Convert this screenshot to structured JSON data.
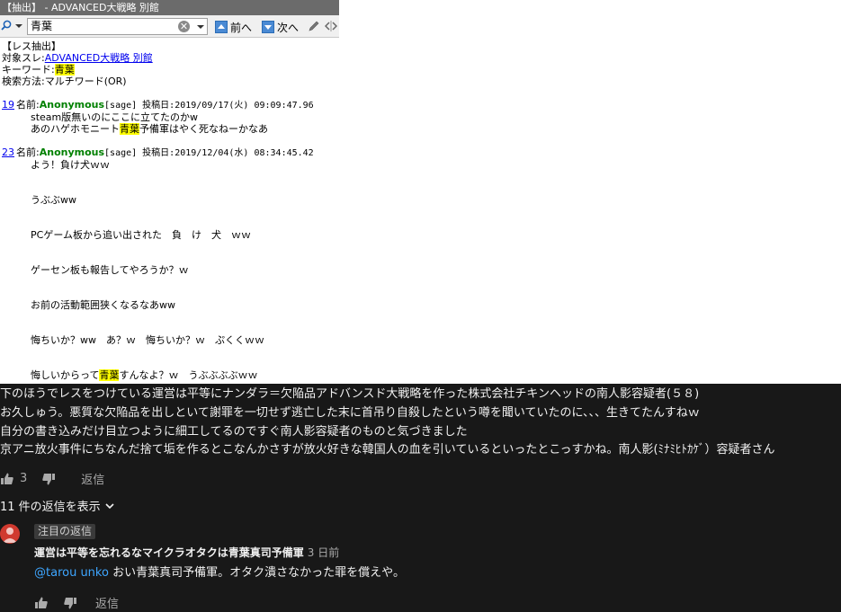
{
  "window": {
    "title": "【抽出】 - ADVANCED大戦略 別館"
  },
  "toolbar": {
    "search_value": "青葉",
    "clear_glyph": "✕",
    "prev_label": "前へ",
    "next_label": "次へ"
  },
  "extract": {
    "header": "【レス抽出】",
    "target_label": "対象スレ:",
    "target_link": "ADVANCED大戦略 別館",
    "keyword_label": "キーワード:",
    "keyword": "青葉",
    "method_line": "検索方法:マルチワード(OR)"
  },
  "posts": [
    {
      "number": "19",
      "name_label": "名前:",
      "name": "Anonymous",
      "mail": "[sage]",
      "date": " 投稿日:2019/09/17(火) 09:09:47.96",
      "lines": [
        {
          "pre": "steam版無いのにここに立てたのかw",
          "hl": "",
          "post": ""
        },
        {
          "pre": "あのハゲホモニート",
          "hl": "青葉",
          "post": "予備軍はやく死なねーかなあ"
        }
      ]
    },
    {
      "number": "23",
      "name_label": "名前:",
      "name": "Anonymous",
      "mail": "[sage]",
      "date": " 投稿日:2019/12/04(水) 08:34:45.42",
      "lines": [
        {
          "pre": "よう！負け犬ｗｗ",
          "hl": "",
          "post": ""
        },
        {
          "pre": "",
          "hl": "",
          "post": ""
        },
        {
          "pre": "",
          "hl": "",
          "post": ""
        },
        {
          "pre": "うぶぶww",
          "hl": "",
          "post": ""
        },
        {
          "pre": "",
          "hl": "",
          "post": ""
        },
        {
          "pre": "",
          "hl": "",
          "post": ""
        },
        {
          "pre": "PCゲーム板から追い出された　負　け　犬　ｗｗ",
          "hl": "",
          "post": ""
        },
        {
          "pre": "",
          "hl": "",
          "post": ""
        },
        {
          "pre": "",
          "hl": "",
          "post": ""
        },
        {
          "pre": "ゲーセン板も報告してやろうか？ｗ",
          "hl": "",
          "post": ""
        },
        {
          "pre": "",
          "hl": "",
          "post": ""
        },
        {
          "pre": "",
          "hl": "",
          "post": ""
        },
        {
          "pre": "お前の活動範囲狭くなるなあww",
          "hl": "",
          "post": ""
        },
        {
          "pre": "",
          "hl": "",
          "post": ""
        },
        {
          "pre": "",
          "hl": "",
          "post": ""
        },
        {
          "pre": "悔ちいか？ww　あ？ｗ　悔ちいか？ｗ　ぷくくｗｗ",
          "hl": "",
          "post": ""
        },
        {
          "pre": "",
          "hl": "",
          "post": ""
        },
        {
          "pre": "",
          "hl": "",
          "post": ""
        },
        {
          "pre": "悔しいからって",
          "hl": "青葉",
          "post": "すんなよ？ｗ　うぶぶぶぶｗｗ"
        }
      ]
    }
  ],
  "comment": {
    "lines": [
      "下のほうでレスをつけている運営は平等にナンダラ＝欠陥品アドバンスド大戦略を作った株式会社チキンヘッドの南人影容疑者(５８)",
      "お久しゅう。悪質な欠陥品を出しといて謝罪を一切せず逃亡した末に首吊り自殺したという噂を聞いていたのに、、、生きてたんすねｗ",
      "自分の書き込みだけ目立つように細工してるのですぐ南人影容疑者のものと気づきました",
      "京アニ放火事件にちなんだ捨て垢を作るとこなんかさすが放火好きな韓国人の血を引いているといったとこっすかね。南人影(ﾐﾅﾐﾋﾄｶｹﾞ）容疑者さん"
    ],
    "like_count": "3",
    "reply_label": "返信",
    "replies_toggle": "11 件の返信を表示"
  },
  "reply": {
    "badge": "注目の返信",
    "author": "運営は平等を忘れるなマイクラオタクは青葉真司予備軍",
    "time": "3 日前",
    "mention": "@tarou unko",
    "text": " おい青葉真司予備軍。オタク潰さなかった罪を償えや。",
    "reply_label": "返信"
  },
  "colors": {
    "titlebar": "#6b6b6b",
    "dark_bg": "#181818",
    "highlight": "#ffff00",
    "anon_green": "#008000",
    "link_blue": "#0000ee",
    "mention_blue": "#3ea6ff",
    "avatar_red": "#d03a2f"
  },
  "icons": [
    "search-icon",
    "dropdown-icon",
    "clear-icon",
    "up-arrow-icon",
    "down-arrow-icon",
    "pen-icon",
    "grip-icon",
    "like-icon",
    "dislike-icon",
    "chevron-down-icon",
    "avatar"
  ]
}
